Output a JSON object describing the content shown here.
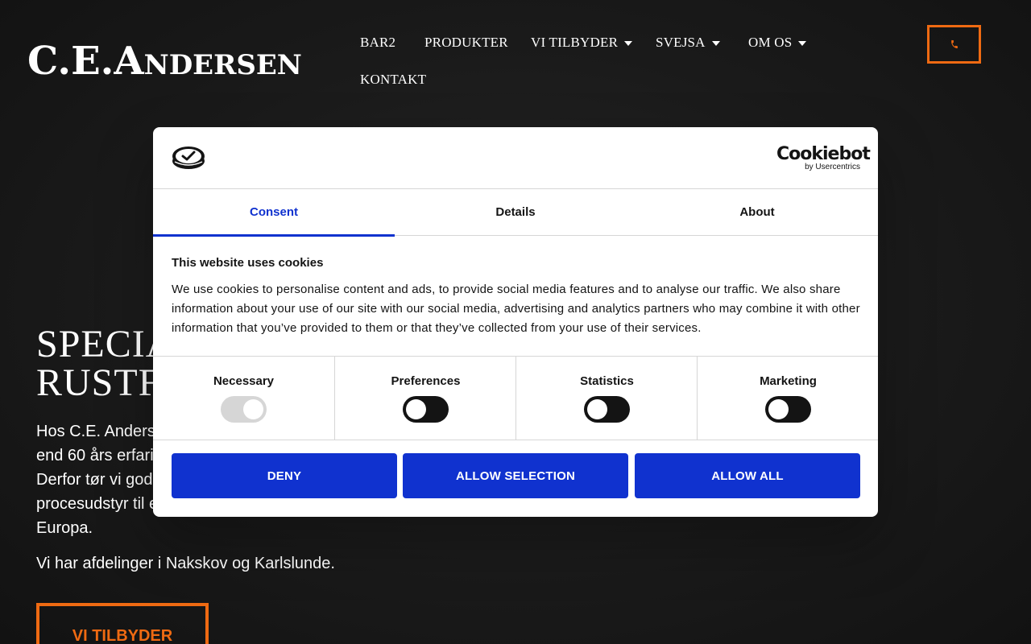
{
  "site": {
    "logo": "C.E.Andersen",
    "nav": [
      {
        "label": "BAR2",
        "dropdown": false
      },
      {
        "label": "PRODUKTER",
        "dropdown": false
      },
      {
        "label": "VI TILBYDER",
        "dropdown": true
      },
      {
        "label": "SVEJSA",
        "dropdown": true
      },
      {
        "label": "OM OS",
        "dropdown": true
      },
      {
        "label": "KONTAKT",
        "dropdown": false
      }
    ],
    "phone_icon": "phone-icon",
    "accent_color": "#ef6a12"
  },
  "hero": {
    "title_line1": "SPECIA",
    "title_line2": "RUSTF",
    "paragraph_lines": [
      "Hos C.E. Anders",
      "end 60 års erfari",
      "Derfor tør vi god",
      "procesudstyr til e",
      "Europa."
    ],
    "paragraph2": "Vi har afdelinger i Nakskov og Karlslunde.",
    "button_label": "VI TILBYDER"
  },
  "cookie_dialog": {
    "brand": "Cookiebot",
    "brand_sub": "by Usercentrics",
    "tabs": [
      {
        "label": "Consent",
        "active": true
      },
      {
        "label": "Details",
        "active": false
      },
      {
        "label": "About",
        "active": false
      }
    ],
    "heading": "This website uses cookies",
    "text": "We use cookies to personalise content and ads, to provide social media features and to analyse our traffic. We also share information about your use of our site with our social media, advertising and analytics partners who may combine it with other information that you’ve provided to them or that they’ve collected from your use of their services.",
    "toggles": [
      {
        "label": "Necessary",
        "enabled": true,
        "disabled": true
      },
      {
        "label": "Preferences",
        "enabled": false,
        "disabled": false
      },
      {
        "label": "Statistics",
        "enabled": false,
        "disabled": false
      },
      {
        "label": "Marketing",
        "enabled": false,
        "disabled": false
      }
    ],
    "buttons": {
      "deny": "DENY",
      "allow_selection": "ALLOW SELECTION",
      "allow_all": "ALLOW ALL"
    },
    "primary_color": "#1032cf"
  }
}
